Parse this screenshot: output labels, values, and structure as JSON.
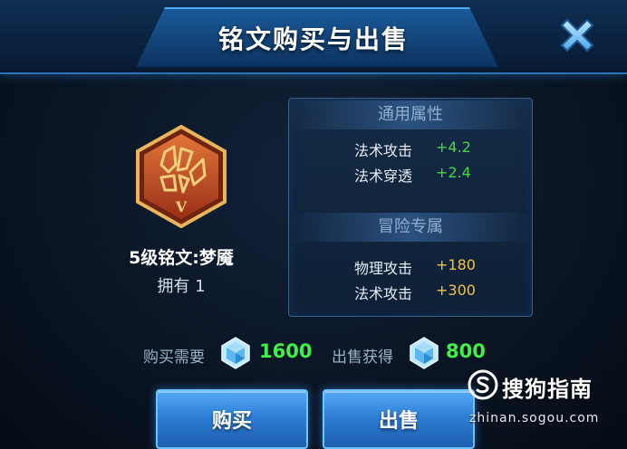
{
  "dialog": {
    "title": "铭文购买与出售",
    "close_icon": "close-x-icon"
  },
  "rune": {
    "icon": "rune-badge-icon",
    "badge_level": "V",
    "name": "5级铭文:梦魇",
    "owned": "拥有 1"
  },
  "attributes": {
    "general": {
      "title": "通用属性",
      "stats": [
        {
          "label": "法术攻击",
          "value": "+4.2"
        },
        {
          "label": "法术穿透",
          "value": "+2.4"
        }
      ]
    },
    "adventure": {
      "title": "冒险专属",
      "stats": [
        {
          "label": "物理攻击",
          "value": "+180"
        },
        {
          "label": "法术攻击",
          "value": "+300"
        }
      ]
    }
  },
  "price": {
    "buy_label": "购买需要",
    "buy_value": "1600",
    "sell_label": "出售获得",
    "sell_value": "800",
    "currency_icon": "diamond-icon"
  },
  "buttons": {
    "buy": "购买",
    "sell": "出售"
  },
  "watermark": {
    "brand": "搜狗指南",
    "url": "zhinan.sogou.com"
  },
  "colors": {
    "header_blue": "#134479",
    "accent_blue": "#6bc3ff",
    "stat_green": "#42d84a",
    "stat_gold": "#f2c34a",
    "price_green": "#3ff04a"
  }
}
